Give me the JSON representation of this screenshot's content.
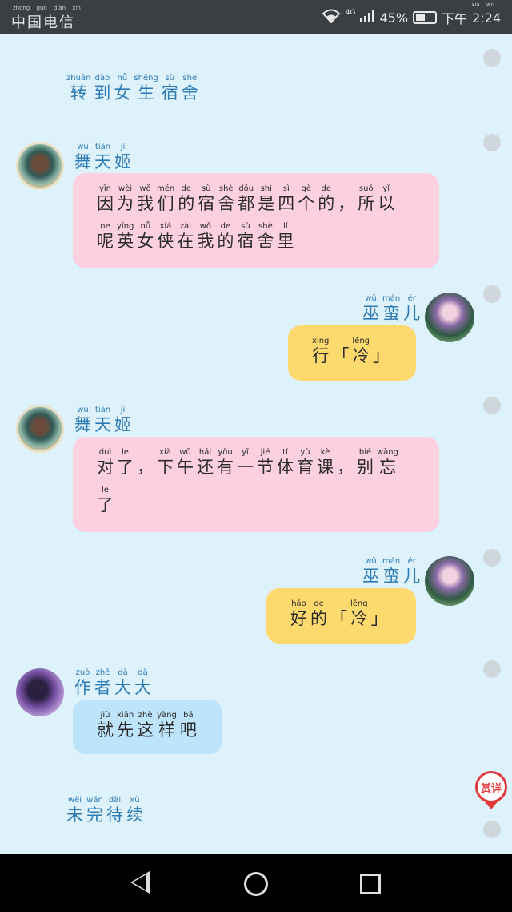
{
  "status_bar": {
    "carrier": {
      "chars": [
        [
          "zhōng",
          "中"
        ],
        [
          "guó",
          "国"
        ],
        [
          "diàn",
          "电"
        ],
        [
          "xìn",
          "信"
        ]
      ]
    },
    "signal_label": "4G",
    "battery": "45%",
    "time": {
      "chars": [
        [
          "xià",
          "下"
        ],
        [
          "wǔ",
          "午"
        ]
      ],
      "clock": "2:24"
    }
  },
  "narration_1": {
    "chars": [
      [
        "zhuǎn",
        "转"
      ],
      [
        "dào",
        "到"
      ],
      [
        "nǚ",
        "女"
      ],
      [
        "shēng",
        "生"
      ],
      [
        "sù",
        "宿"
      ],
      [
        "shè",
        "舍"
      ]
    ]
  },
  "messages": [
    {
      "sender": {
        "chars": [
          [
            "wǔ",
            "舞"
          ],
          [
            "tiān",
            "天"
          ],
          [
            "jī",
            "姬"
          ]
        ]
      },
      "lines": [
        [
          [
            "yīn",
            "因"
          ],
          [
            "wèi",
            "为"
          ],
          [
            "wǒ",
            "我"
          ],
          [
            "mén",
            "们"
          ],
          [
            "de",
            "的"
          ],
          [
            "sù",
            "宿"
          ],
          [
            "shè",
            "舍"
          ],
          [
            "dōu",
            "都"
          ],
          [
            "shì",
            "是"
          ],
          [
            "sì",
            "四"
          ],
          [
            "gè",
            "个"
          ],
          [
            "de",
            "的"
          ],
          [
            "",
            "，"
          ],
          [
            "suǒ",
            "所"
          ],
          [
            "yǐ",
            "以"
          ]
        ],
        [
          [
            "ne",
            "呢"
          ],
          [
            "yīng",
            "英"
          ],
          [
            "nǚ",
            "女"
          ],
          [
            "xiá",
            "侠"
          ],
          [
            "zài",
            "在"
          ],
          [
            "wǒ",
            "我"
          ],
          [
            "de",
            "的"
          ],
          [
            "sù",
            "宿"
          ],
          [
            "shè",
            "舍"
          ],
          [
            "lǐ",
            "里"
          ]
        ]
      ]
    },
    {
      "sender": {
        "chars": [
          [
            "wū",
            "巫"
          ],
          [
            "mán",
            "蛮"
          ],
          [
            "ér",
            "儿"
          ]
        ]
      },
      "lines": [
        [
          [
            "xíng",
            "行"
          ],
          [
            "",
            "「"
          ],
          [
            "lěng",
            "冷"
          ],
          [
            "",
            "」"
          ]
        ]
      ]
    },
    {
      "sender": {
        "chars": [
          [
            "wǔ",
            "舞"
          ],
          [
            "tiān",
            "天"
          ],
          [
            "jī",
            "姬"
          ]
        ]
      },
      "lines": [
        [
          [
            "duì",
            "对"
          ],
          [
            "le",
            "了"
          ],
          [
            "",
            "，"
          ],
          [
            "xià",
            "下"
          ],
          [
            "wǔ",
            "午"
          ],
          [
            "hái",
            "还"
          ],
          [
            "yǒu",
            "有"
          ],
          [
            "yī",
            "一"
          ],
          [
            "jié",
            "节"
          ],
          [
            "tǐ",
            "体"
          ],
          [
            "yù",
            "育"
          ],
          [
            "kè",
            "课"
          ],
          [
            "",
            "，"
          ],
          [
            "bié",
            "别"
          ],
          [
            "wàng",
            "忘"
          ]
        ],
        [
          [
            "le",
            "了"
          ]
        ]
      ]
    },
    {
      "sender": {
        "chars": [
          [
            "wū",
            "巫"
          ],
          [
            "mán",
            "蛮"
          ],
          [
            "ér",
            "儿"
          ]
        ]
      },
      "lines": [
        [
          [
            "hǎo",
            "好"
          ],
          [
            "de",
            "的"
          ],
          [
            "",
            "「"
          ],
          [
            "lěng",
            "冷"
          ],
          [
            "",
            "」"
          ]
        ]
      ]
    },
    {
      "sender": {
        "chars": [
          [
            "zuò",
            "作"
          ],
          [
            "zhě",
            "者"
          ],
          [
            "dà",
            "大"
          ],
          [
            "dà",
            "大"
          ]
        ]
      },
      "lines": [
        [
          [
            "jiù",
            "就"
          ],
          [
            "xiān",
            "先"
          ],
          [
            "zhè",
            "这"
          ],
          [
            "yàng",
            "样"
          ],
          [
            "bā",
            "吧"
          ]
        ]
      ]
    }
  ],
  "narration_2": {
    "chars": [
      [
        "wèi",
        "未"
      ],
      [
        "wán",
        "完"
      ],
      [
        "dài",
        "待"
      ],
      [
        "xù",
        "续"
      ]
    ]
  },
  "reward": {
    "label": "赏详"
  },
  "colors": {
    "background": "#def2fc",
    "pink_bubble": "#fcd0de",
    "yellow_bubble": "#fed96e",
    "blue_bubble": "#bde4fb",
    "name_blue": "#2e7bb3"
  }
}
